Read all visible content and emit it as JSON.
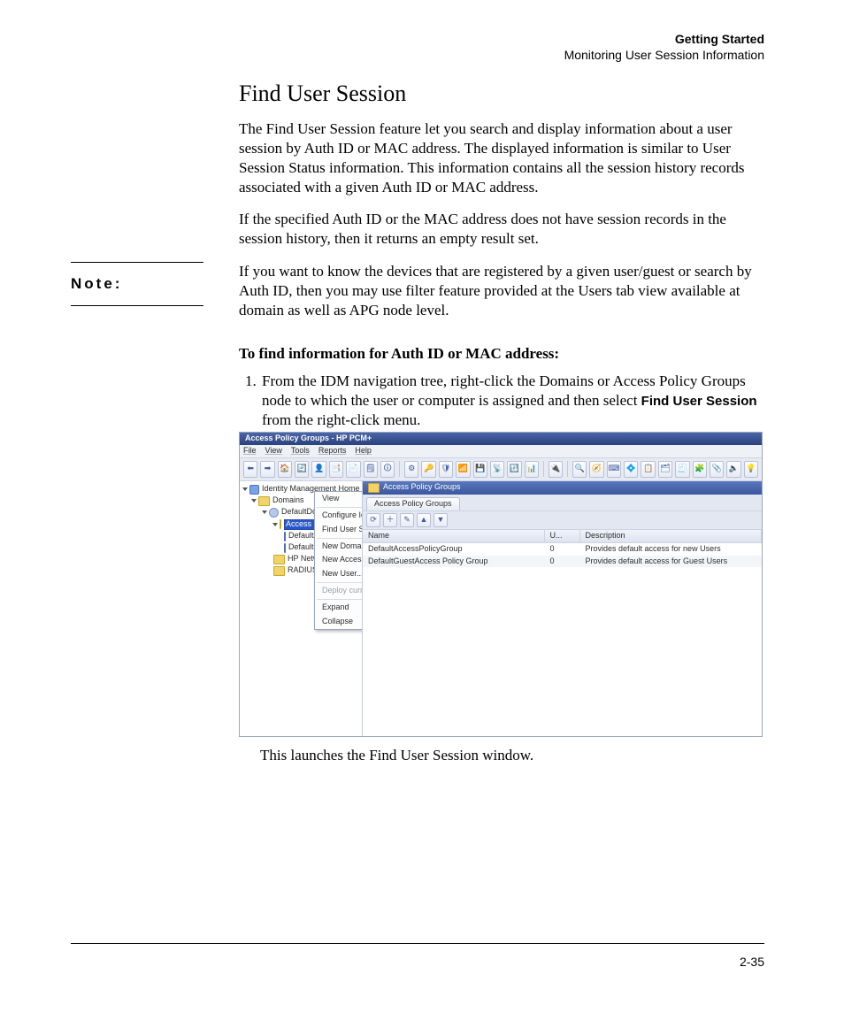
{
  "header": {
    "line1": "Getting Started",
    "line2": "Monitoring User Session Information"
  },
  "section_title": "Find User Session",
  "paragraphs": {
    "p1": "The Find User Session feature let you search and display information about a user session by Auth ID or MAC address. The displayed information is similar to User Session Status information. This information contains all the session history records associated with a given Auth ID or MAC address.",
    "p2": "If the specified Auth ID or the MAC address does not have session records in the session history, then it returns an empty result set."
  },
  "note": {
    "label": "Note:",
    "text": "If you want to know the devices that are registered by a given user/guest or search by Auth ID, then you may use filter feature provided at the Users tab view available at domain as well as APG node level."
  },
  "procedure": {
    "heading": "To find information for Auth ID or MAC address:",
    "step1_a": "From the IDM navigation tree, right-click the Domains or Access Policy Groups node to which the user or computer is assigned and then select ",
    "step1_bold": "Find User Session",
    "step1_b": " from the right-click menu.",
    "after": "This launches the Find User Session window."
  },
  "screenshot": {
    "window_title": "Access Policy Groups - HP PCM+",
    "menus": [
      "File",
      "View",
      "Tools",
      "Reports",
      "Help"
    ],
    "toolbar_glyphs": [
      "⬅",
      "➡",
      "🏠",
      "🔄",
      "👤",
      "📑",
      "📄",
      "🗒",
      "🛈",
      "⚙",
      "🔑",
      "🛡",
      "📶",
      "💾",
      "📡",
      "🔃",
      "📊",
      "🔌",
      "🔍",
      "🧭",
      "⌨",
      "💠",
      "📋",
      "🗂",
      "🧾",
      "🧩",
      "📎",
      "🔈",
      "💡"
    ],
    "tree": {
      "root": "Identity Management Home",
      "domains": "Domains",
      "default_domain": "DefaultDomain",
      "apg": "Access Policy Groups",
      "children": [
        "DefaultAccessPolicyGroup",
        "DefaultGuestAccess",
        "HP Network",
        "RADIUS Default"
      ]
    },
    "breadcrumb": "Access Policy Groups",
    "tab": "Access Policy Groups",
    "grid": {
      "headers": [
        "Name",
        "U...",
        "Description"
      ],
      "rows": [
        {
          "name": "DefaultAccessPolicyGroup",
          "u": "0",
          "desc": "Provides default access for new Users"
        },
        {
          "name": "DefaultGuestAccess Policy Group",
          "u": "0",
          "desc": "Provides default access for Guest Users"
        }
      ]
    },
    "context_menu": [
      "View",
      "Configure Identity Management...",
      "Find User Session...",
      "New Domain...",
      "New Access Policy Group...",
      "New User...",
      "Deploy current policy to this domain",
      "Expand",
      "Collapse"
    ]
  },
  "page_number": "2-35"
}
